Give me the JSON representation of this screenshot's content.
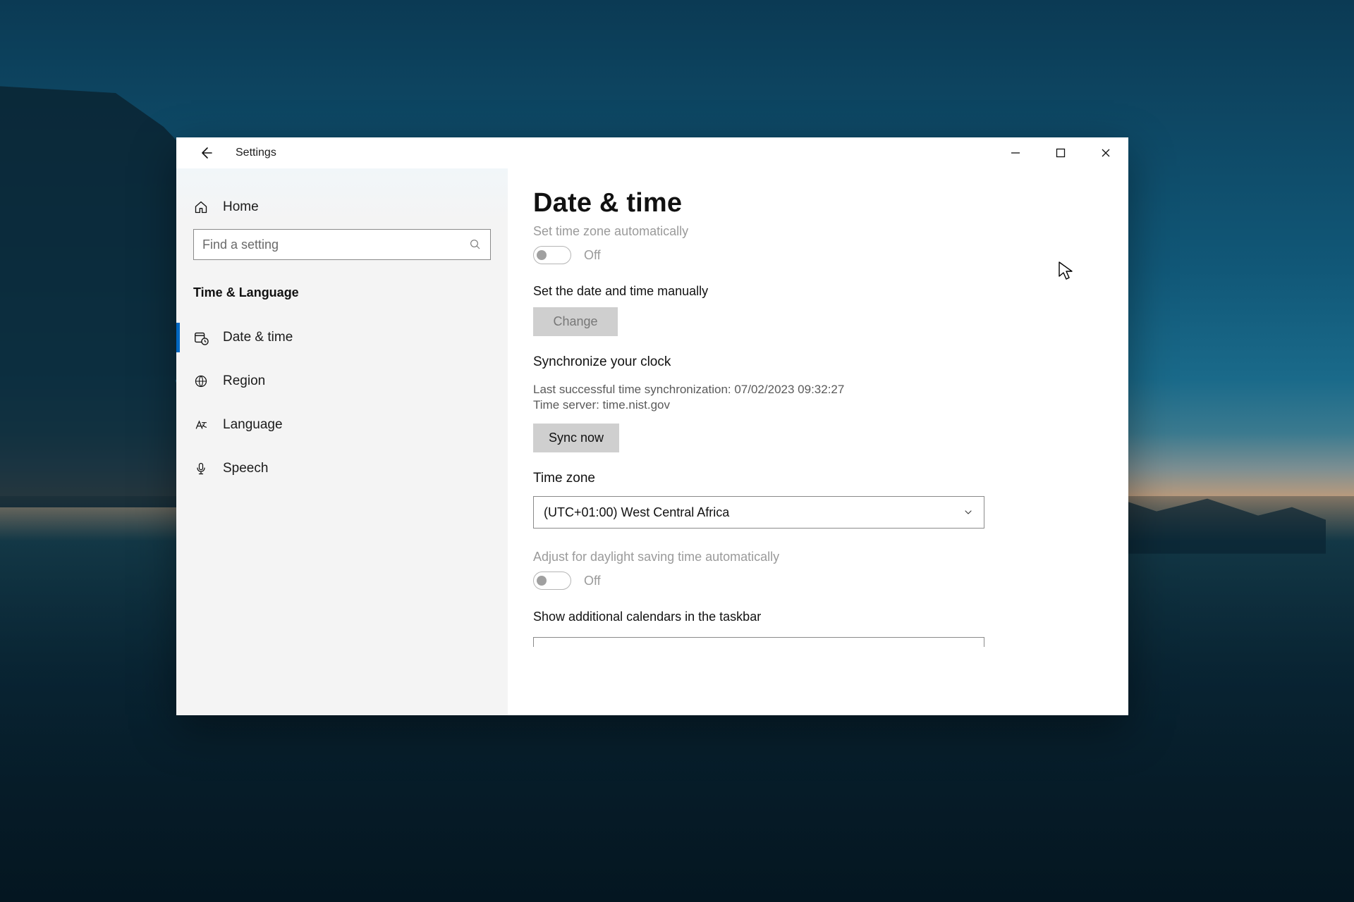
{
  "window": {
    "title": "Settings"
  },
  "sidebar": {
    "home_label": "Home",
    "search_placeholder": "Find a setting",
    "group_title": "Time & Language",
    "items": [
      {
        "label": "Date & time"
      },
      {
        "label": "Region"
      },
      {
        "label": "Language"
      },
      {
        "label": "Speech"
      }
    ]
  },
  "content": {
    "page_title": "Date & time",
    "auto_timezone": {
      "label": "Set time zone automatically",
      "state": "Off"
    },
    "manual_datetime": {
      "label": "Set the date and time manually",
      "button": "Change"
    },
    "sync": {
      "heading": "Synchronize your clock",
      "last_sync": "Last successful time synchronization: 07/02/2023 09:32:27",
      "server": "Time server: time.nist.gov",
      "button": "Sync now"
    },
    "timezone": {
      "label": "Time zone",
      "value": "(UTC+01:00) West Central Africa"
    },
    "dst": {
      "label": "Adjust for daylight saving time automatically",
      "state": "Off"
    },
    "additional_calendars": {
      "label": "Show additional calendars in the taskbar"
    }
  }
}
